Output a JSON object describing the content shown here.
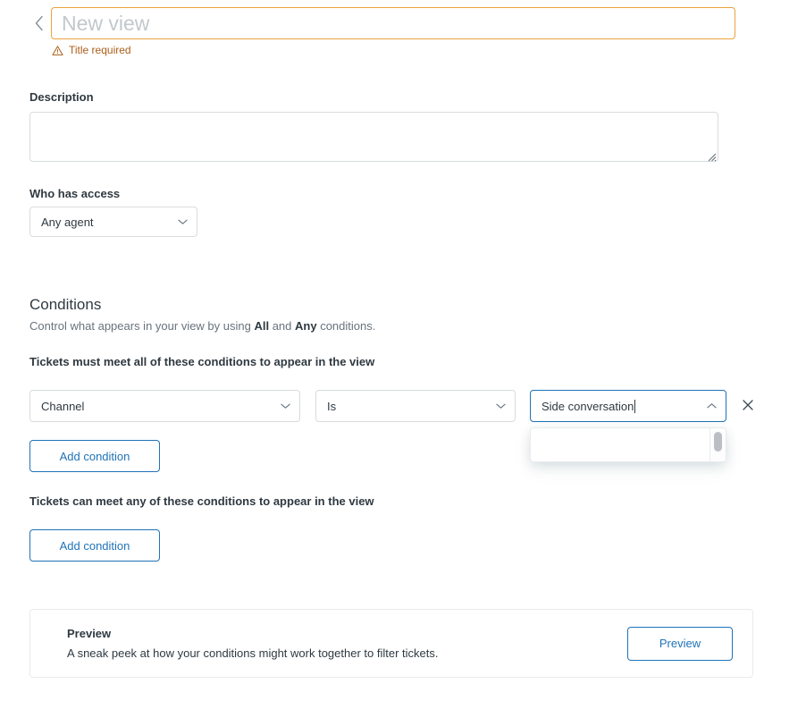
{
  "header": {
    "back_icon": "chevron-left-icon",
    "title_value": "",
    "title_placeholder": "New view",
    "error_icon": "warning-triangle-icon",
    "error_text": "Title required",
    "error_color": "#ad5e18",
    "input_border_color": "#e8a33d"
  },
  "description": {
    "label": "Description",
    "value": "",
    "placeholder": ""
  },
  "access": {
    "label": "Who has access",
    "selected": "Any agent",
    "chevron_icon": "chevron-down-icon"
  },
  "conditions": {
    "heading": "Conditions",
    "subtitle_prefix": "Control what appears in your view by using ",
    "subtitle_all": "All",
    "subtitle_mid": " and ",
    "subtitle_any": "Any",
    "subtitle_suffix": " conditions.",
    "all_group_title": "Tickets must meet all of these conditions to appear in the view",
    "any_group_title": "Tickets can meet any of these conditions to appear in the view",
    "add_condition_all_label": "Add condition",
    "add_condition_any_label": "Add condition",
    "rows": [
      {
        "field": "Channel",
        "field_chevron_icon": "chevron-down-icon",
        "operator": "Is",
        "operator_chevron_icon": "chevron-down-icon",
        "value": "Side conversation",
        "value_chevron_icon": "chevron-up-icon",
        "value_focused": true,
        "remove_icon": "close-icon",
        "dropdown_open": true,
        "dropdown_options": [],
        "dropdown_has_scrollbar": true
      }
    ]
  },
  "preview": {
    "title": "Preview",
    "description": "A sneak peek at how your conditions might work together to filter tickets.",
    "button_label": "Preview"
  },
  "theme": {
    "accent_blue": "#1f73b7",
    "border_gray": "#d8dcde",
    "text_primary": "#2f3941",
    "text_secondary": "#68737d",
    "warning_orange": "#e8a33d"
  }
}
